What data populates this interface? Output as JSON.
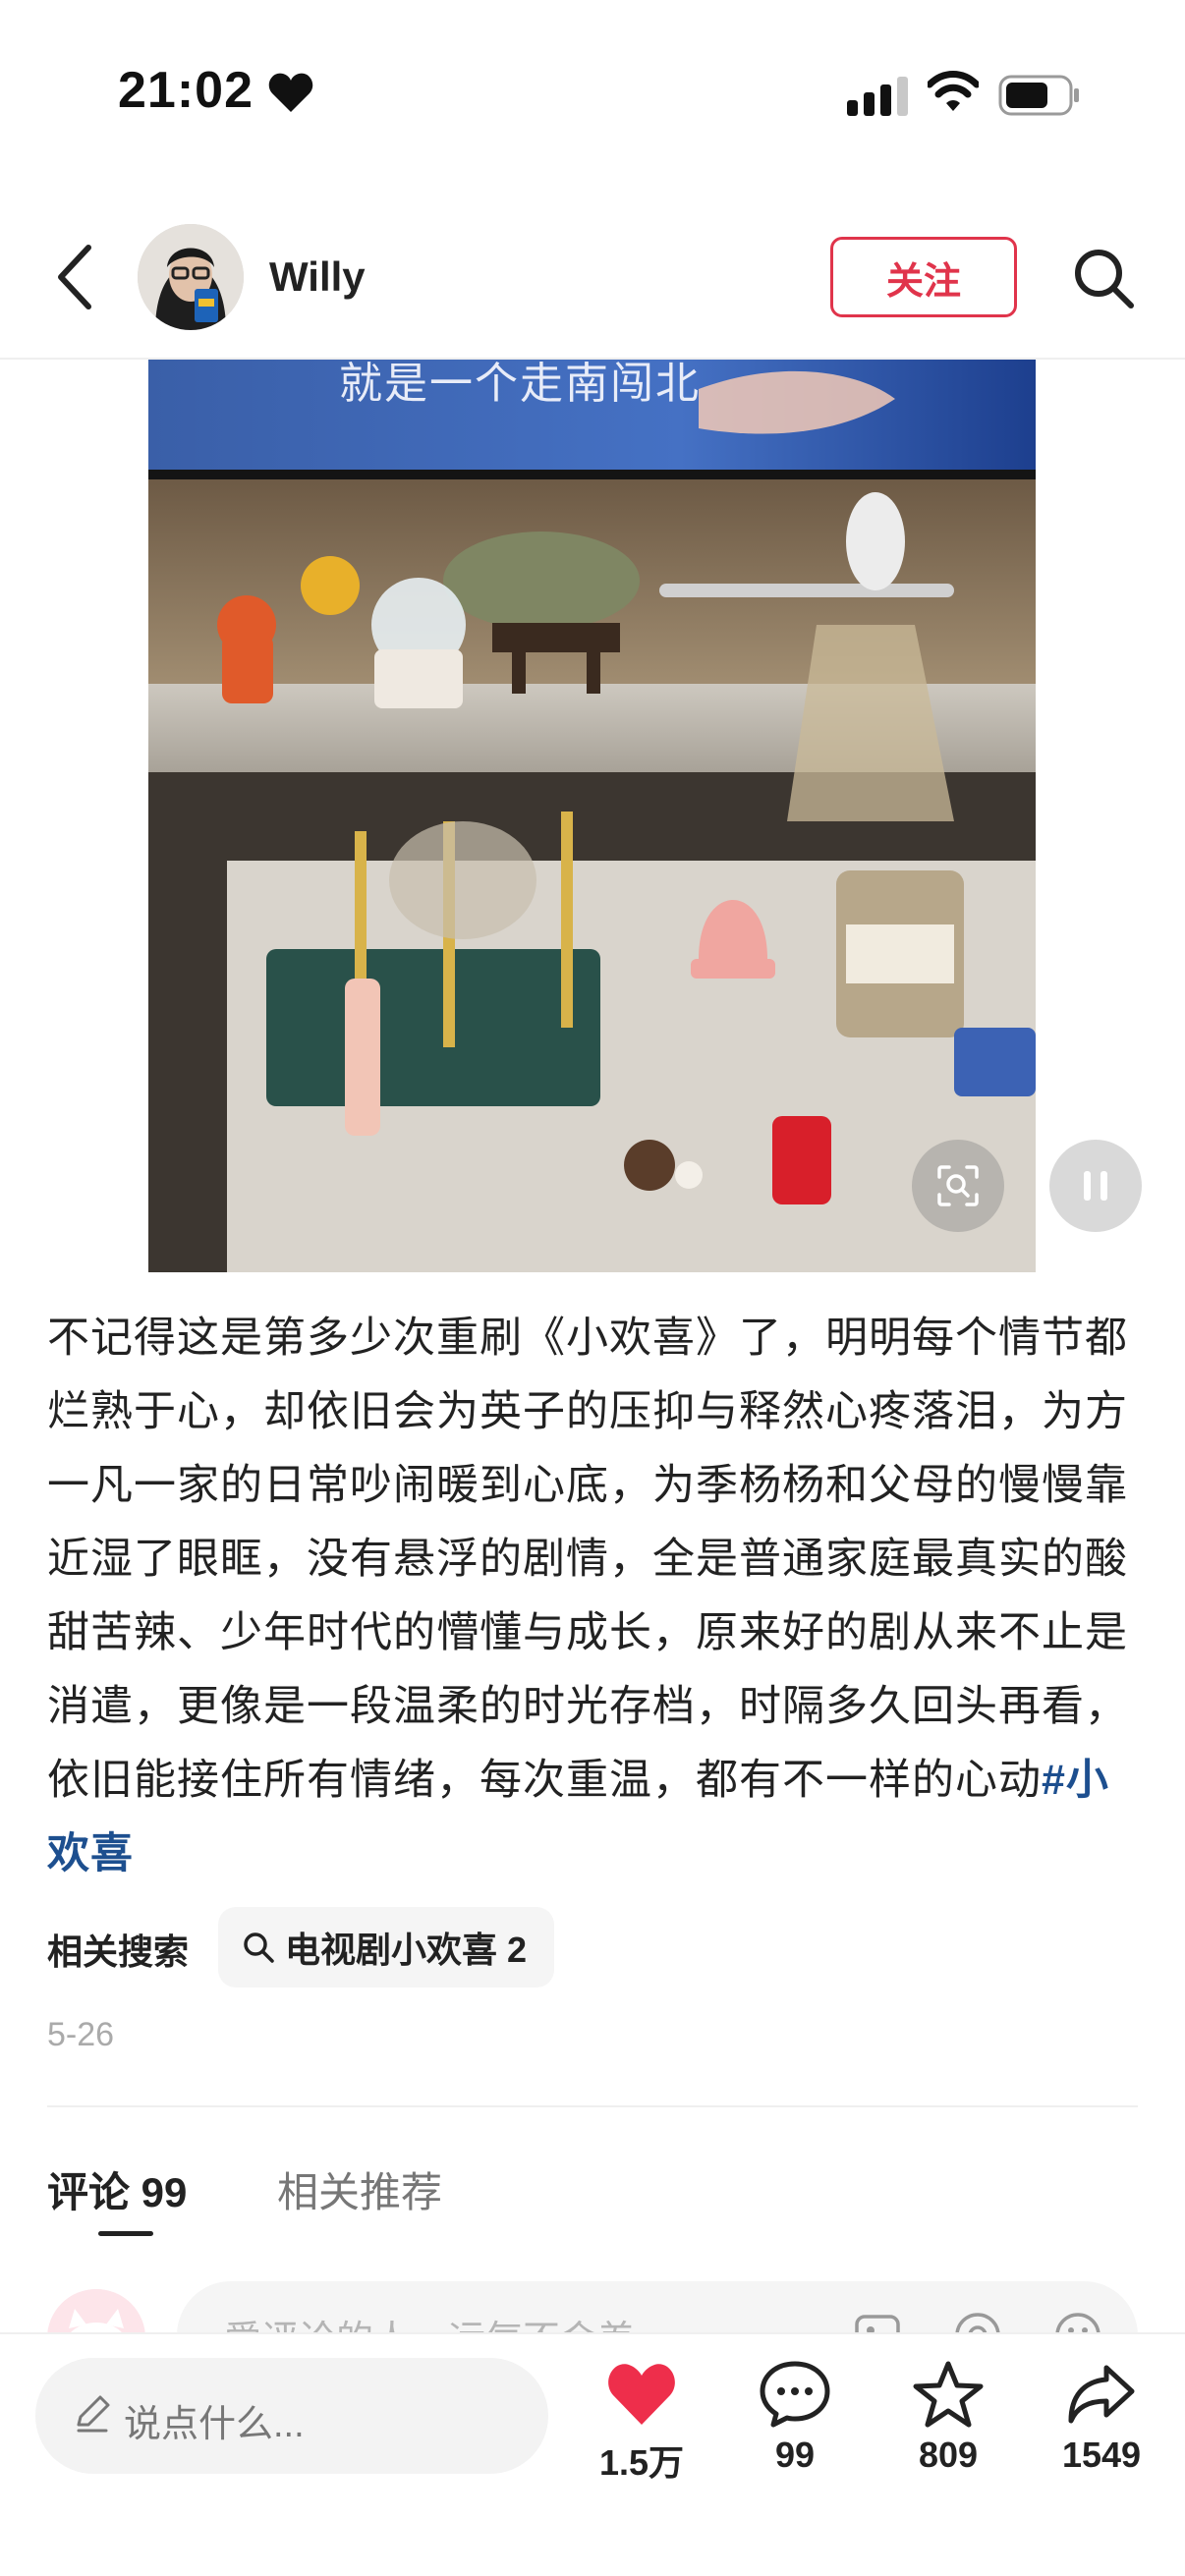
{
  "status_bar": {
    "time": "21:02"
  },
  "header": {
    "username": "Willy",
    "follow_label": "关注"
  },
  "media": {
    "subtitle": "就是一个走南闯北"
  },
  "post": {
    "caption": "不记得这是第多少次重刷《小欢喜》了，明明每个情节都烂熟于心，却依旧会为英子的压抑与释然心疼落泪，为方一凡一家的日常吵闹暖到心底，为季杨杨和父母的慢慢靠近湿了眼眶，没有悬浮的剧情，全是普通家庭最真实的酸甜苦辣、少年时代的懵懂与成长，原来好的剧从来不止是消遣，更像是一段温柔的时光存档，时隔多久回头再看，依旧能接住所有情绪，每次重温，都有不一样的心动",
    "hashtag": "#小欢喜",
    "related_search_label": "相关搜索",
    "related_search_query": "电视剧小欢喜 2",
    "date": "5-26"
  },
  "tabs": {
    "comments": "评论 99",
    "related": "相关推荐"
  },
  "comment_input": {
    "placeholder": "爱评论的人，运气不会差"
  },
  "bottom_bar": {
    "say_placeholder": "说点什么...",
    "likes": "1.5万",
    "comments": "99",
    "favorites": "809",
    "shares": "1549"
  },
  "colors": {
    "accent_red": "#e0344b",
    "hashtag_blue": "#1d4f8f"
  },
  "icons": [
    "heart-icon",
    "signal-icon",
    "wifi-icon",
    "battery-icon",
    "back-icon",
    "search-icon",
    "lens-icon",
    "pause-icon",
    "pencil-icon",
    "like-icon",
    "comment-icon",
    "star-icon",
    "share-icon",
    "image-icon",
    "at-icon",
    "emoji-icon"
  ]
}
